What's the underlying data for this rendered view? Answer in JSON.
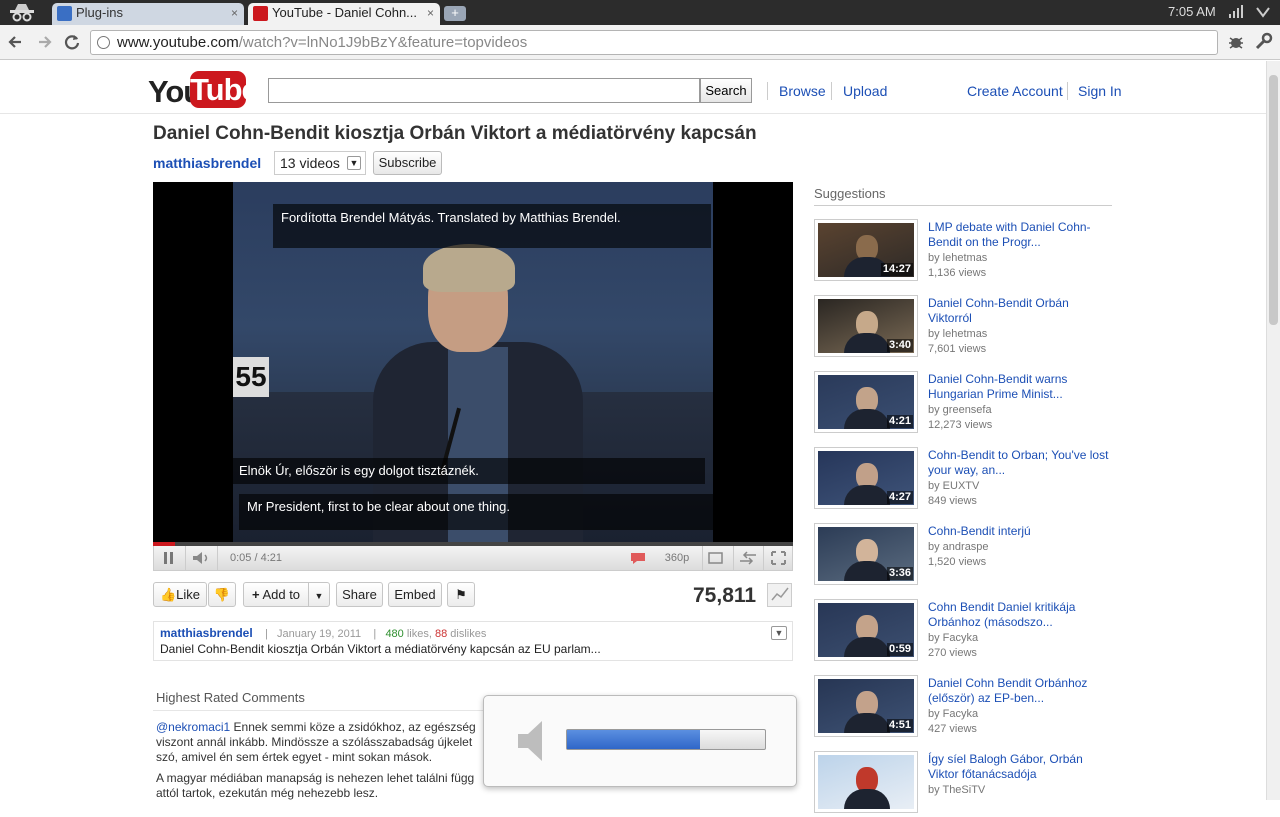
{
  "browser": {
    "tabs": [
      {
        "label": "Plug-ins",
        "close": "×"
      },
      {
        "label": "YouTube - Daniel Cohn...",
        "close": "×"
      }
    ],
    "new_tab": "+",
    "clock": "7:05 AM",
    "url_host": "www.youtube.com",
    "url_path": "/watch?v=lnNo1J9bBzY&feature=topvideos"
  },
  "header": {
    "logo_you": "You",
    "logo_tube": "Tube",
    "search_button": "Search",
    "search_placeholder": "",
    "links": {
      "browse": "Browse",
      "upload": "Upload",
      "create_account": "Create Account",
      "sign_in": "Sign In"
    }
  },
  "video": {
    "title": "Daniel Cohn-Bendit kiosztja Orbán Viktort a médiatörvény kapcsán",
    "channel": "matthiasbrendel",
    "videos_count": "13 videos",
    "subscribe": "Subscribe",
    "seat_number": "55",
    "subtitles": {
      "top": "Fordította Brendel Mátyás. Translated by Matthias Brendel.",
      "hu": "Elnök Úr, először is egy dolgot tisztáznék.",
      "en": "Mr President, first to be clear about one thing."
    },
    "progress_fraction": 0.034,
    "time": "0:05 / 4:21",
    "quality": "360p"
  },
  "actions": {
    "like": "Like",
    "add_to": "Add to",
    "share": "Share",
    "embed": "Embed",
    "views": "75,811"
  },
  "info": {
    "channel": "matthiasbrendel",
    "sep": "|",
    "date": "January 19, 2011",
    "likes": "480",
    "likes_word": " likes, ",
    "dislikes": "88",
    "dislikes_word": " dislikes",
    "description": "Daniel Cohn-Bendit kiosztja Orbán Viktort a médiatörvény kapcsán az EU parlam..."
  },
  "comments": {
    "heading": "Highest Rated Comments",
    "items": [
      {
        "user": "@nekromaci1",
        "line1": " Ennek semmi köze a zsidókhoz, az egészség",
        "line2": "viszont annál inkább. Mindössze a szólásszabadság újkelet",
        "line3": "szó, amivel én sem értek egyet - mint sokan mások."
      },
      {
        "line1": "A magyar médiában manapság is nehezen lehet találni függ",
        "line2": "attól tartok, ezekután még nehezebb lesz."
      }
    ]
  },
  "suggestions": {
    "heading": "Suggestions",
    "items": [
      {
        "title": "LMP debate with Daniel Cohn-Bendit on the Progr...",
        "by": "by lehetmas",
        "views": "1,136 views",
        "duration": "14:27"
      },
      {
        "title": "Daniel Cohn-Bendit Orbán Viktorról",
        "by": "by lehetmas",
        "views": "7,601 views",
        "duration": "3:40"
      },
      {
        "title": "Daniel Cohn-Bendit warns Hungarian Prime Minist...",
        "by": "by greensefa",
        "views": "12,273 views",
        "duration": "4:21"
      },
      {
        "title": "Cohn-Bendit to Orban; You've lost your way, an...",
        "by": "by EUXTV",
        "views": "849 views",
        "duration": "4:27"
      },
      {
        "title": "Cohn-Bendit interjú",
        "by": "by andraspe",
        "views": "1,520 views",
        "duration": "3:36"
      },
      {
        "title": "Cohn Bendit Daniel kritikája Orbánhoz (másodszo...",
        "by": "by Facyka",
        "views": "270 views",
        "duration": "0:59"
      },
      {
        "title": "Daniel Cohn Bendit Orbánhoz (először) az EP-ben...",
        "by": "by Facyka",
        "views": "427 views",
        "duration": "4:51"
      },
      {
        "title": "Így síel Balogh Gábor, Orbán Viktor főtanácsadója",
        "by": "by TheSiTV",
        "views": "",
        "duration": ""
      }
    ]
  },
  "volume": {
    "level_fraction": 0.67
  },
  "colors": {
    "link": "#1c4fb5",
    "brand_red": "#cc181e",
    "likes_green": "#2f8f2f",
    "dislikes_red": "#cc3333",
    "volume_blue": "#2f66c8"
  }
}
